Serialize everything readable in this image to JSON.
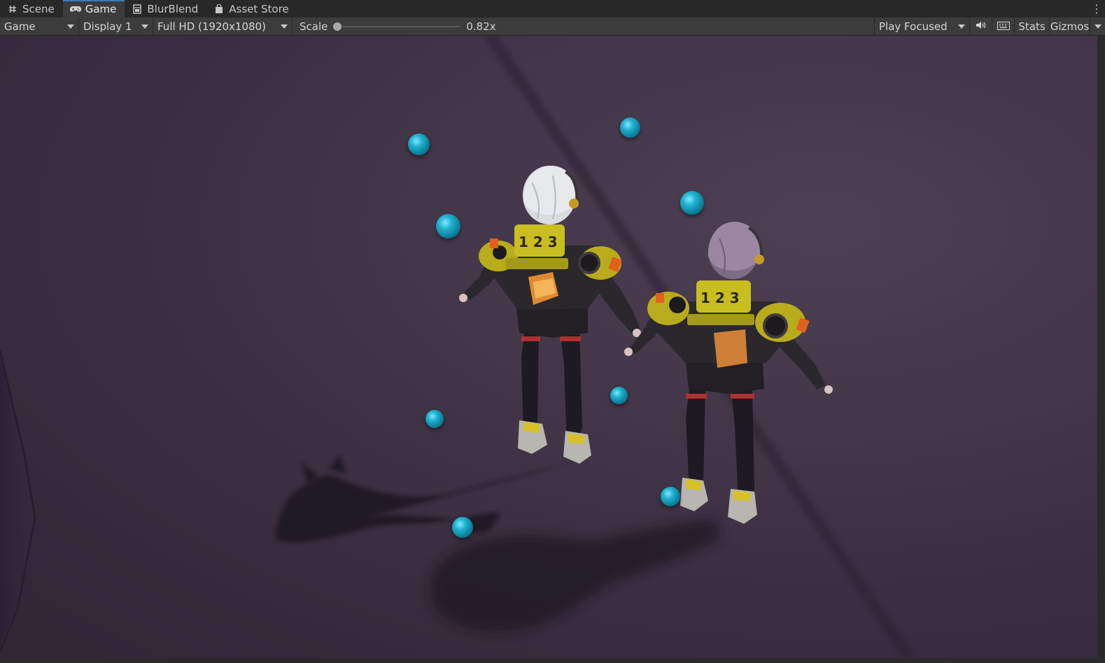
{
  "tabs": [
    {
      "label": "Scene",
      "icon": "hash-icon"
    },
    {
      "label": "Game",
      "icon": "gamepad-icon"
    },
    {
      "label": "BlurBlend",
      "icon": "window-icon"
    },
    {
      "label": "Asset Store",
      "icon": "bag-icon"
    }
  ],
  "active_tab": "Game",
  "toolbar": {
    "view_select": "Game",
    "display_select": "Display 1",
    "resolution_select": "Full HD (1920x1080)",
    "scale_label": "Scale",
    "scale_value": "0.82x",
    "scale_fraction": 0.0,
    "play_mode": "Play Focused",
    "audio_icon": "speaker-icon",
    "keyboard_icon": "keyboard-icon",
    "stats_label": "Stats",
    "gizmos_label": "Gizmos"
  },
  "colors": {
    "accent": "#3a79bb",
    "sphere": "#1fb1cf",
    "floor": "#3f3345",
    "hair_left": "#dcdde2",
    "hair_right": "#8e7898",
    "jacket_accent": "#c9be20"
  }
}
